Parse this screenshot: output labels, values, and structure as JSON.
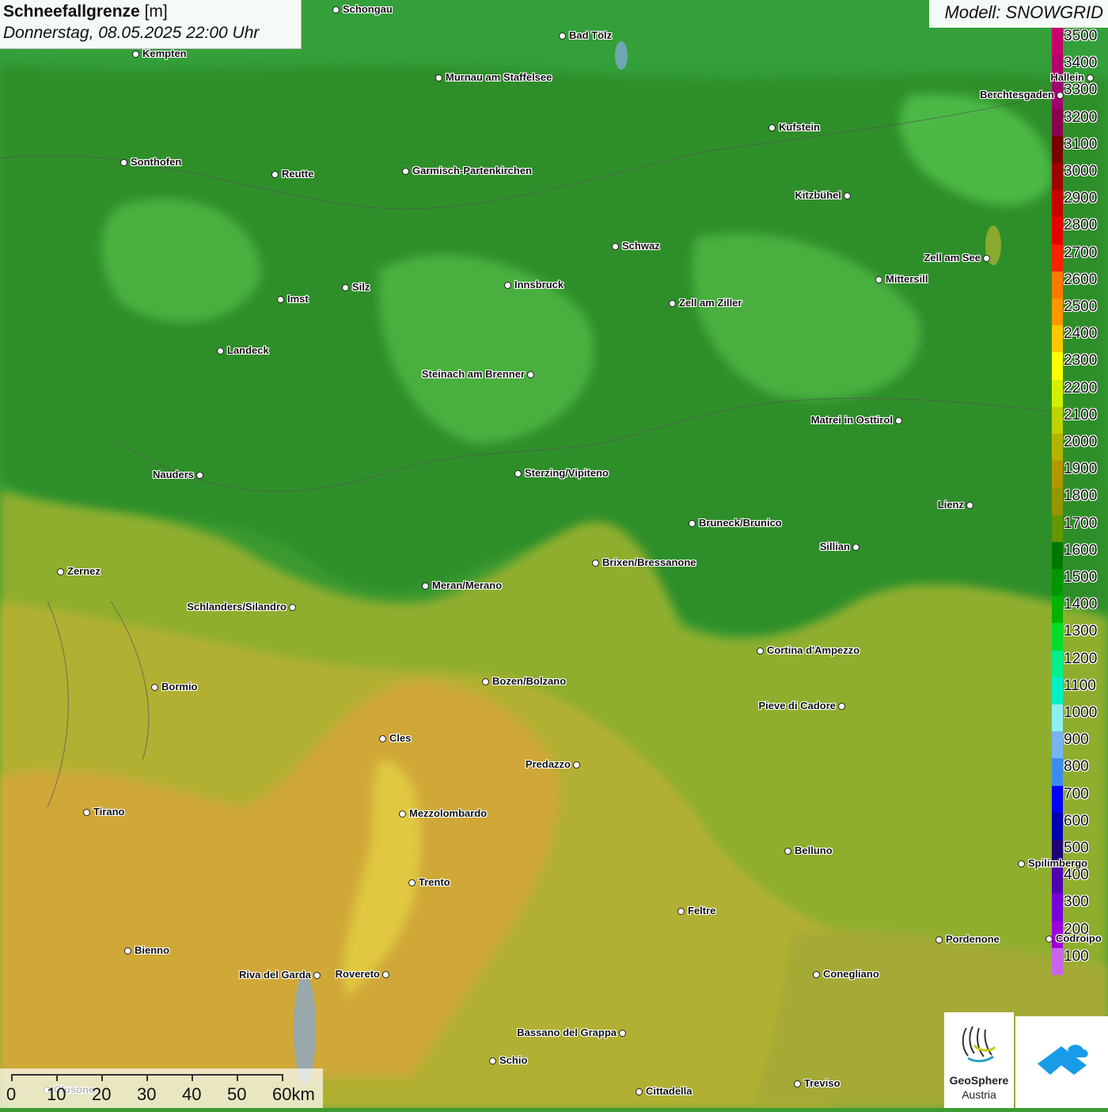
{
  "title": {
    "main": "Schneefallgrenze",
    "unit": "[m]",
    "subtitle": "Donnerstag, 08.05.2025 22:00 Uhr"
  },
  "model_label": "Modell: SNOWGRID",
  "legend": {
    "unit": "m",
    "entries": [
      {
        "label": "3500",
        "color": "#c8006e"
      },
      {
        "label": "3400",
        "color": "#b4006e"
      },
      {
        "label": "3300",
        "color": "#a0006e"
      },
      {
        "label": "3200",
        "color": "#8c0050"
      },
      {
        "label": "3100",
        "color": "#780000"
      },
      {
        "label": "3000",
        "color": "#a00000"
      },
      {
        "label": "2900",
        "color": "#c80000"
      },
      {
        "label": "2800",
        "color": "#e60000"
      },
      {
        "label": "2700",
        "color": "#ff2000"
      },
      {
        "label": "2600",
        "color": "#ff7800"
      },
      {
        "label": "2500",
        "color": "#ff9600"
      },
      {
        "label": "2400",
        "color": "#ffc800"
      },
      {
        "label": "2300",
        "color": "#ffff00"
      },
      {
        "label": "2200",
        "color": "#d2f000"
      },
      {
        "label": "2100",
        "color": "#bed200"
      },
      {
        "label": "2000",
        "color": "#b4b400"
      },
      {
        "label": "1900",
        "color": "#b49600"
      },
      {
        "label": "1800",
        "color": "#969600"
      },
      {
        "label": "1700",
        "color": "#649600"
      },
      {
        "label": "1600",
        "color": "#007800"
      },
      {
        "label": "1500",
        "color": "#009600"
      },
      {
        "label": "1400",
        "color": "#00b400"
      },
      {
        "label": "1300",
        "color": "#00dc28"
      },
      {
        "label": "1200",
        "color": "#00f08c"
      },
      {
        "label": "1100",
        "color": "#00f0c8"
      },
      {
        "label": "1000",
        "color": "#8cf0f0"
      },
      {
        "label": "900",
        "color": "#78b4f0"
      },
      {
        "label": "800",
        "color": "#3c8cf0"
      },
      {
        "label": "700",
        "color": "#0000ff"
      },
      {
        "label": "600",
        "color": "#0000b4"
      },
      {
        "label": "500",
        "color": "#1e0078"
      },
      {
        "label": "400",
        "color": "#5000b4"
      },
      {
        "label": "300",
        "color": "#7800dc"
      },
      {
        "label": "200",
        "color": "#a000dc"
      },
      {
        "label": "100",
        "color": "#c864f0"
      }
    ]
  },
  "cities": [
    {
      "name": "Schongau"
    },
    {
      "name": "Bad Tölz"
    },
    {
      "name": "Kempten"
    },
    {
      "name": "Murnau am Staffelsee"
    },
    {
      "name": "Hallein"
    },
    {
      "name": "Berchtesgaden"
    },
    {
      "name": "Kufstein"
    },
    {
      "name": "Sonthofen"
    },
    {
      "name": "Reutte"
    },
    {
      "name": "Garmisch-Partenkirchen"
    },
    {
      "name": "Kitzbühel"
    },
    {
      "name": "Schwaz"
    },
    {
      "name": "Zell am See"
    },
    {
      "name": "Innsbruck"
    },
    {
      "name": "Mittersill"
    },
    {
      "name": "Imst"
    },
    {
      "name": "Silz"
    },
    {
      "name": "Zell am Ziller"
    },
    {
      "name": "Landeck"
    },
    {
      "name": "Steinach am Brenner"
    },
    {
      "name": "Matrei in Osttirol"
    },
    {
      "name": "Nauders"
    },
    {
      "name": "Sterzing/Vipiteno"
    },
    {
      "name": "Lienz"
    },
    {
      "name": "Bruneck/Brunico"
    },
    {
      "name": "Sillian"
    },
    {
      "name": "Zernez"
    },
    {
      "name": "Brixen/Bressanone"
    },
    {
      "name": "Meran/Merano"
    },
    {
      "name": "Schlanders/Silandro"
    },
    {
      "name": "Cortina d'Ampezzo"
    },
    {
      "name": "Bozen/Bolzano"
    },
    {
      "name": "Bormio"
    },
    {
      "name": "Pieve di Cadore"
    },
    {
      "name": "Cles"
    },
    {
      "name": "Predazzo"
    },
    {
      "name": "Tirano"
    },
    {
      "name": "Mezzolombardo"
    },
    {
      "name": "Belluno"
    },
    {
      "name": "Spilimbergo"
    },
    {
      "name": "Trento"
    },
    {
      "name": "Feltre"
    },
    {
      "name": "Pordenone"
    },
    {
      "name": "Codroipo"
    },
    {
      "name": "Bienno"
    },
    {
      "name": "Riva del Garda"
    },
    {
      "name": "Rovereto"
    },
    {
      "name": "Conegliano"
    },
    {
      "name": "Bassano del Grappa"
    },
    {
      "name": "Schio"
    },
    {
      "name": "Treviso"
    },
    {
      "name": "Cittadella"
    },
    {
      "name": "Clusone"
    }
  ],
  "scale": {
    "ticks": [
      "0",
      "10",
      "20",
      "30",
      "40",
      "50",
      "60km"
    ]
  },
  "logos": {
    "geosphere_line1": "GeoSphere",
    "geosphere_line2": "Austria"
  }
}
